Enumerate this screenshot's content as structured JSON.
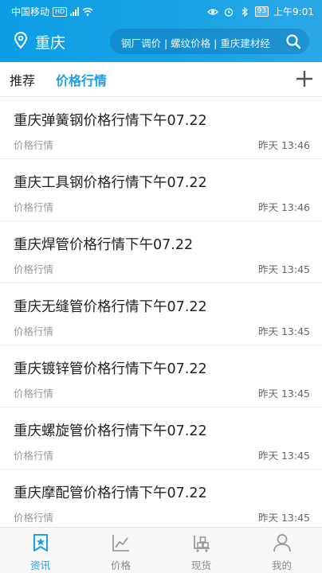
{
  "status_bar": {
    "carrier": "中国移动",
    "hd_badge": "HD",
    "battery": "93",
    "time": "上午9:01"
  },
  "header": {
    "city": "重庆",
    "search_hint": "钢厂调价 | 螺纹价格 | 重庆建材经"
  },
  "tabs": [
    {
      "label": "推荐"
    },
    {
      "label": "价格行情"
    }
  ],
  "news": [
    {
      "title": "重庆弹簧钢价格行情下午07.22",
      "category": "价格行情",
      "time": "昨天 13:46"
    },
    {
      "title": "重庆工具钢价格行情下午07.22",
      "category": "价格行情",
      "time": "昨天 13:46"
    },
    {
      "title": "重庆焊管价格行情下午07.22",
      "category": "价格行情",
      "time": "昨天 13:45"
    },
    {
      "title": "重庆无缝管价格行情下午07.22",
      "category": "价格行情",
      "time": "昨天 13:45"
    },
    {
      "title": "重庆镀锌管价格行情下午07.22",
      "category": "价格行情",
      "time": "昨天 13:45"
    },
    {
      "title": "重庆螺旋管价格行情下午07.22",
      "category": "价格行情",
      "time": "昨天 13:45"
    },
    {
      "title": "重庆摩配管价格行情下午07.22",
      "category": "价格行情",
      "time": "昨天 13:45"
    }
  ],
  "bottom_nav": [
    {
      "label": "资讯",
      "icon": "news-icon"
    },
    {
      "label": "价格",
      "icon": "chart-icon"
    },
    {
      "label": "现货",
      "icon": "goods-icon"
    },
    {
      "label": "我的",
      "icon": "profile-icon"
    }
  ],
  "colors": {
    "brand_blue": "#1aa0e6",
    "header_blue": "#0d9ee5"
  }
}
